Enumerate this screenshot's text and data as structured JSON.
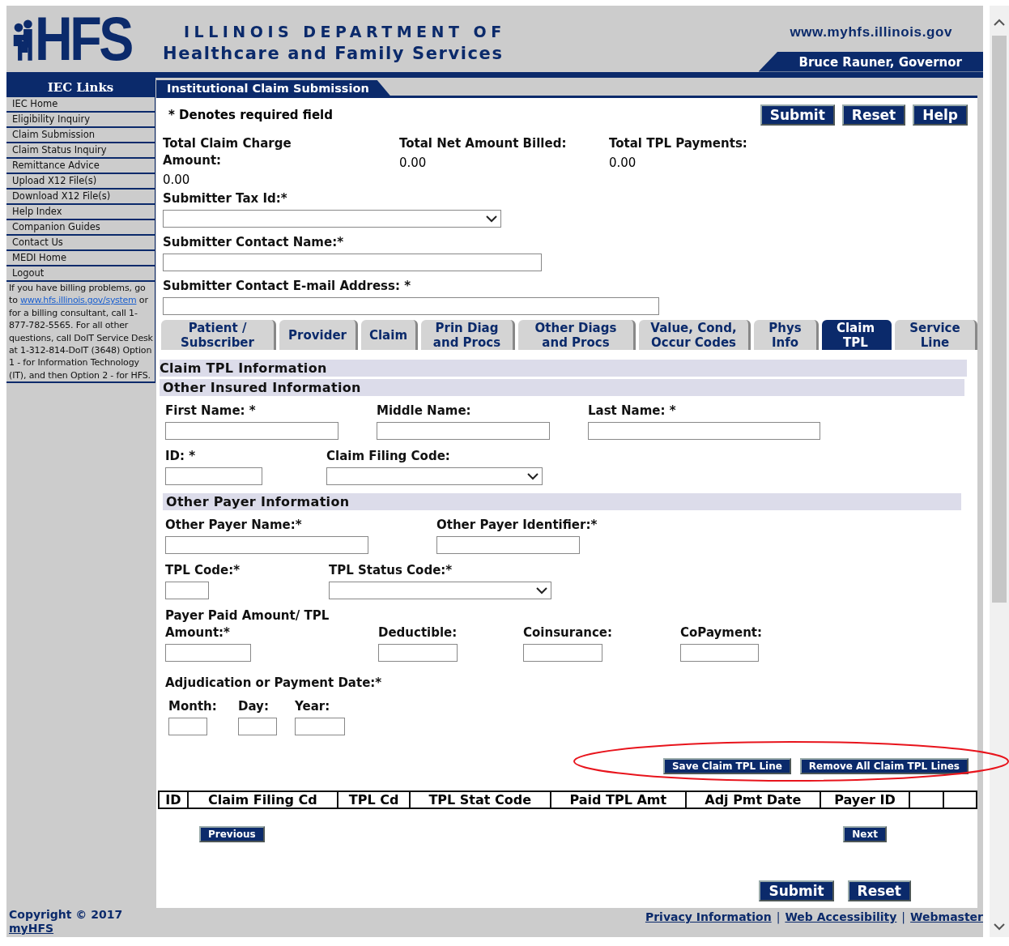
{
  "header": {
    "logo": "HFS",
    "title_line_1": "ILLINOIS DEPARTMENT OF",
    "title_line_2": "Healthcare and Family Services",
    "website": "www.myhfs.illinois.gov",
    "governor": "Bruce Rauner, Governor"
  },
  "sidebar": {
    "title": "IEC Links",
    "items": [
      "IEC Home",
      "Eligibility Inquiry",
      "Claim Submission",
      "Claim Status Inquiry",
      "Remittance Advice",
      "Upload X12 File(s)",
      "Download X12 File(s)",
      "Help Index",
      "Companion Guides",
      "Contact Us",
      "MEDI Home",
      "Logout"
    ],
    "help_before": "If you have billing problems, go to",
    "help_link": "www.hfs.illinois.gov/system",
    "help_after": "or for a billing consultant, call 1-877-782-5565. For all other questions, call DoIT Service Desk at 1-312-814-DoIT (3648) Option 1 - for Information Technology (IT), and then Option 2 - for HFS."
  },
  "page_title": "Institutional Claim Submission",
  "required_note": "* Denotes required field",
  "top_buttons": [
    "Submit",
    "Reset",
    "Help"
  ],
  "totals": [
    {
      "label": "Total Claim Charge Amount:",
      "value": "0.00"
    },
    {
      "label": "Total Net Amount Billed:",
      "value": "0.00"
    },
    {
      "label": "Total TPL Payments:",
      "value": "0.00"
    }
  ],
  "submitter_fields": [
    {
      "label": "Submitter Tax Id:*",
      "kind": "select"
    },
    {
      "label": "Submitter Contact Name:*",
      "kind": "text"
    },
    {
      "label": "Submitter Contact E-mail Address: *",
      "kind": "text"
    }
  ],
  "tabs": [
    {
      "label": "Patient / Subscriber",
      "selected": false
    },
    {
      "label": "Provider",
      "selected": false
    },
    {
      "label": "Claim",
      "selected": false
    },
    {
      "label": "Prin Diag and Procs",
      "selected": false
    },
    {
      "label": "Other Diags and Procs",
      "selected": false
    },
    {
      "label": "Value, Cond, Occur Codes",
      "selected": false
    },
    {
      "label": "Phys Info",
      "selected": false
    },
    {
      "label": "Claim TPL",
      "selected": true
    },
    {
      "label": "Service Line",
      "selected": false
    }
  ],
  "section_title": "Claim TPL Information",
  "other_insured": {
    "title": "Other Insured Information",
    "rows": [
      [
        {
          "label": "First Name: *",
          "kind": "text"
        },
        {
          "label": "Middle Name:",
          "kind": "text"
        },
        {
          "label": "Last Name: *",
          "kind": "text"
        }
      ],
      [
        {
          "label": "ID: *",
          "kind": "text"
        },
        {
          "label": "Claim Filing Code:",
          "kind": "select"
        }
      ]
    ]
  },
  "other_payer": {
    "title": "Other Payer Information",
    "rows": [
      [
        {
          "label": "Other Payer Name:*",
          "kind": "text"
        },
        {
          "label": "Other Payer Identifier:*",
          "kind": "text"
        }
      ],
      [
        {
          "label": "TPL Code:*",
          "kind": "text"
        },
        {
          "label": "TPL Status Code:*",
          "kind": "select"
        }
      ],
      [
        {
          "label": "Payer Paid Amount/ TPL Amount:*",
          "kind": "text"
        },
        {
          "label": "Deductible:",
          "kind": "text"
        },
        {
          "label": "Coinsurance:",
          "kind": "text"
        },
        {
          "label": "CoPayment:",
          "kind": "text"
        }
      ]
    ]
  },
  "date": {
    "title": "Adjudication or Payment Date:*",
    "fields": [
      {
        "label": "Month:",
        "kind": "text"
      },
      {
        "label": "Day:",
        "kind": "text"
      },
      {
        "label": "Year:",
        "kind": "text"
      }
    ]
  },
  "line_buttons": [
    "Save Claim TPL Line",
    "Remove All Claim TPL Lines"
  ],
  "table": {
    "columns": [
      "ID",
      "Claim Filing Cd",
      "TPL Cd",
      "TPL Stat Code",
      "Paid TPL Amt",
      "Adj Pmt Date",
      "Payer ID"
    ]
  },
  "pager": {
    "previous": "Previous",
    "next": "Next"
  },
  "bottom_buttons": [
    "Submit",
    "Reset"
  ],
  "footer": {
    "copyright": "Copyright © 2017",
    "home_link": "myHFS",
    "items": [
      {
        "kind": "link",
        "text": "Privacy Information"
      },
      {
        "kind": "separator",
        "text": "|"
      },
      {
        "kind": "link",
        "text": "Web Accessibility"
      },
      {
        "kind": "separator",
        "text": "|"
      },
      {
        "kind": "link",
        "text": "Webmaster"
      }
    ]
  }
}
